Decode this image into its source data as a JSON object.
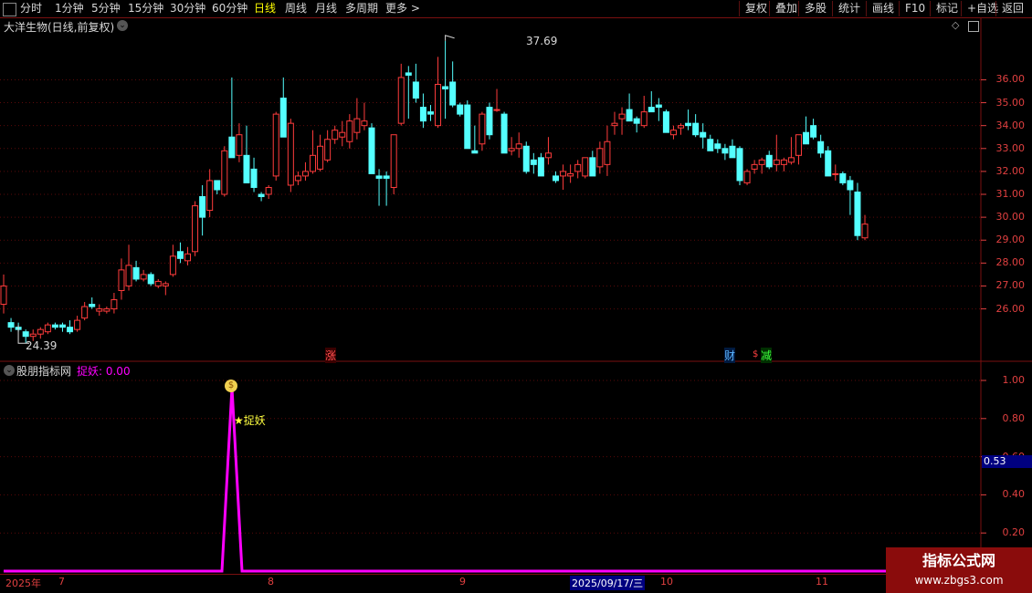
{
  "toolbar": {
    "left": [
      {
        "label": "分时"
      },
      {
        "label": "1分钟"
      },
      {
        "label": "5分钟"
      },
      {
        "label": "15分钟"
      },
      {
        "label": "30分钟"
      },
      {
        "label": "60分钟"
      },
      {
        "label": "日线",
        "active": true
      },
      {
        "label": "周线"
      },
      {
        "label": "月线"
      },
      {
        "label": "多周期"
      },
      {
        "label": "更多 >"
      }
    ],
    "right": [
      {
        "label": "复权"
      },
      {
        "label": "叠加"
      },
      {
        "label": "多股"
      },
      {
        "label": "统计"
      },
      {
        "label": "画线"
      },
      {
        "label": "F10"
      },
      {
        "label": "标记"
      },
      {
        "label": "+自选"
      },
      {
        "label": "返回"
      }
    ]
  },
  "stock_title": "大洋生物(日线,前复权)",
  "max_label": "37.69",
  "min_label": "24.39",
  "price_axis": [
    "36.00",
    "35.00",
    "34.00",
    "33.00",
    "32.00",
    "31.00",
    "30.00",
    "29.00",
    "28.00",
    "27.00",
    "26.00"
  ],
  "markers": {
    "zhang": "涨",
    "cai": "财",
    "jian": "减"
  },
  "indicator": {
    "source": "股朋指标网",
    "name_value": "捉妖: 0.00",
    "signal_label": "★捉妖",
    "axis": [
      "1.00",
      "0.80",
      "0.60",
      "0.40",
      "0.20"
    ],
    "current_value": "0.53"
  },
  "dates": {
    "year": "2025年",
    "m7": "7",
    "m8": "8",
    "m9": "9",
    "cursor": "2025/09/17/三",
    "m10": "10",
    "m11": "11"
  },
  "watermark": {
    "title": "指标公式网",
    "url": "www.zbgs3.com"
  },
  "colors": {
    "up": "#ff3c3c",
    "down": "#54ffff",
    "indicator": "#ff00ff",
    "axis": "#e04040",
    "grid": "#5a0a0a"
  },
  "chart_data": {
    "type": "candlestick",
    "ohlc": [
      [
        26.2,
        27.5,
        25.8,
        27.0
      ],
      [
        25.4,
        25.6,
        25.0,
        25.2
      ],
      [
        25.2,
        25.4,
        25.0,
        25.1
      ],
      [
        25.0,
        25.1,
        24.5,
        24.8
      ],
      [
        24.8,
        25.1,
        24.6,
        24.9
      ],
      [
        24.9,
        25.2,
        24.7,
        25.1
      ],
      [
        25.0,
        25.4,
        24.9,
        25.3
      ],
      [
        25.3,
        25.4,
        25.1,
        25.2
      ],
      [
        25.3,
        25.4,
        25.0,
        25.2
      ],
      [
        25.2,
        25.5,
        24.9,
        25.0
      ],
      [
        25.1,
        25.7,
        25.0,
        25.5
      ],
      [
        25.6,
        26.3,
        25.5,
        26.1
      ],
      [
        26.2,
        26.5,
        26.0,
        26.1
      ],
      [
        25.9,
        26.2,
        25.7,
        26.0
      ],
      [
        25.9,
        26.1,
        25.8,
        26.0
      ],
      [
        26.0,
        26.7,
        25.8,
        26.4
      ],
      [
        26.8,
        28.2,
        26.4,
        27.7
      ],
      [
        27.0,
        28.8,
        26.8,
        27.9
      ],
      [
        27.8,
        28.1,
        27.2,
        27.3
      ],
      [
        27.3,
        27.7,
        27.2,
        27.5
      ],
      [
        27.5,
        27.6,
        27.0,
        27.1
      ],
      [
        27.0,
        27.3,
        26.9,
        27.2
      ],
      [
        27.0,
        27.2,
        26.6,
        27.1
      ],
      [
        27.5,
        28.8,
        27.4,
        28.3
      ],
      [
        28.5,
        28.9,
        28.0,
        28.2
      ],
      [
        28.1,
        28.7,
        27.9,
        28.4
      ],
      [
        28.5,
        30.7,
        28.3,
        30.5
      ],
      [
        30.9,
        31.4,
        29.2,
        30.0
      ],
      [
        30.3,
        32.1,
        30.0,
        31.6
      ],
      [
        31.6,
        31.6,
        31.0,
        31.2
      ],
      [
        31.0,
        33.1,
        30.9,
        32.9
      ],
      [
        33.5,
        36.1,
        32.7,
        32.6
      ],
      [
        32.7,
        34.1,
        32.4,
        33.6
      ],
      [
        32.7,
        34.0,
        31.7,
        31.5
      ],
      [
        32.1,
        32.6,
        31.1,
        31.3
      ],
      [
        31.0,
        31.1,
        30.7,
        30.9
      ],
      [
        31.0,
        31.4,
        30.8,
        31.3
      ],
      [
        31.8,
        34.6,
        31.6,
        34.5
      ],
      [
        35.2,
        36.1,
        33.6,
        33.5
      ],
      [
        31.4,
        34.3,
        31.1,
        34.1
      ],
      [
        31.6,
        32.0,
        31.4,
        31.8
      ],
      [
        31.8,
        32.4,
        31.6,
        32.0
      ],
      [
        32.0,
        33.8,
        31.9,
        32.7
      ],
      [
        32.1,
        33.6,
        32.0,
        33.1
      ],
      [
        32.5,
        33.8,
        32.4,
        33.4
      ],
      [
        33.4,
        34.0,
        33.2,
        33.8
      ],
      [
        33.5,
        34.2,
        33.1,
        33.7
      ],
      [
        33.3,
        34.5,
        33.0,
        34.2
      ],
      [
        33.7,
        35.2,
        33.4,
        34.3
      ],
      [
        34.0,
        35.0,
        33.8,
        34.2
      ],
      [
        33.9,
        34.1,
        31.9,
        31.9
      ],
      [
        31.8,
        32.1,
        30.5,
        31.7
      ],
      [
        31.8,
        32.0,
        30.5,
        31.7
      ],
      [
        31.3,
        33.6,
        31.0,
        33.6
      ],
      [
        34.1,
        36.7,
        34.0,
        36.1
      ],
      [
        36.3,
        36.6,
        34.3,
        36.2
      ],
      [
        35.9,
        36.7,
        35.0,
        35.2
      ],
      [
        34.8,
        35.4,
        33.9,
        34.2
      ],
      [
        34.6,
        34.9,
        34.2,
        34.5
      ],
      [
        34.0,
        37.0,
        33.9,
        35.8
      ],
      [
        35.7,
        37.7,
        34.3,
        35.6
      ],
      [
        35.9,
        36.8,
        34.8,
        34.9
      ],
      [
        34.9,
        35.0,
        34.4,
        34.5
      ],
      [
        34.9,
        35.1,
        33.2,
        33.0
      ],
      [
        32.9,
        34.0,
        32.8,
        32.8
      ],
      [
        33.2,
        34.6,
        32.9,
        34.5
      ],
      [
        34.8,
        35.0,
        33.4,
        33.6
      ],
      [
        34.7,
        35.6,
        34.6,
        34.7
      ],
      [
        34.5,
        34.6,
        33.0,
        32.8
      ],
      [
        32.9,
        33.5,
        32.7,
        33.0
      ],
      [
        33.0,
        33.7,
        32.6,
        33.2
      ],
      [
        33.1,
        33.3,
        31.9,
        32.0
      ],
      [
        32.5,
        32.8,
        31.9,
        32.3
      ],
      [
        32.6,
        32.8,
        31.8,
        31.8
      ],
      [
        32.6,
        33.5,
        32.3,
        32.8
      ],
      [
        31.8,
        32.0,
        31.5,
        31.6
      ],
      [
        31.8,
        32.3,
        31.2,
        32.0
      ],
      [
        31.8,
        32.3,
        31.5,
        31.9
      ],
      [
        32.0,
        32.5,
        31.7,
        32.3
      ],
      [
        31.8,
        32.6,
        31.7,
        32.6
      ],
      [
        32.6,
        32.9,
        31.8,
        31.8
      ],
      [
        32.2,
        33.3,
        31.9,
        33.0
      ],
      [
        32.3,
        34.0,
        31.8,
        33.3
      ],
      [
        34.0,
        34.6,
        33.6,
        34.1
      ],
      [
        34.3,
        34.8,
        33.6,
        34.5
      ],
      [
        34.7,
        35.4,
        34.3,
        34.2
      ],
      [
        34.3,
        34.4,
        33.7,
        34.1
      ],
      [
        34.0,
        35.3,
        33.9,
        34.6
      ],
      [
        34.8,
        35.5,
        34.6,
        34.6
      ],
      [
        34.9,
        35.2,
        34.2,
        34.8
      ],
      [
        34.6,
        34.7,
        33.7,
        33.7
      ],
      [
        33.6,
        34.0,
        33.4,
        33.8
      ],
      [
        33.9,
        34.1,
        33.6,
        34.0
      ],
      [
        34.1,
        34.7,
        33.8,
        34.0
      ],
      [
        34.1,
        34.5,
        33.5,
        33.6
      ],
      [
        33.7,
        34.1,
        33.0,
        33.5
      ],
      [
        33.4,
        33.6,
        32.9,
        32.9
      ],
      [
        33.2,
        33.4,
        32.8,
        33.0
      ],
      [
        33.0,
        33.2,
        32.5,
        32.8
      ],
      [
        33.1,
        33.4,
        32.9,
        32.6
      ],
      [
        33.0,
        33.1,
        31.4,
        31.6
      ],
      [
        31.5,
        32.1,
        31.4,
        32.0
      ],
      [
        32.1,
        32.5,
        31.9,
        32.3
      ],
      [
        32.3,
        32.6,
        31.9,
        32.5
      ],
      [
        32.7,
        32.9,
        32.1,
        32.2
      ],
      [
        32.3,
        33.6,
        32.0,
        32.5
      ],
      [
        32.3,
        32.6,
        32.0,
        32.5
      ],
      [
        32.4,
        33.5,
        32.3,
        32.6
      ],
      [
        32.7,
        33.1,
        32.3,
        33.6
      ],
      [
        33.7,
        34.4,
        33.6,
        33.2
      ],
      [
        34.0,
        34.3,
        33.4,
        33.5
      ],
      [
        33.3,
        33.6,
        32.6,
        32.8
      ],
      [
        32.9,
        33.1,
        31.9,
        31.8
      ],
      [
        31.9,
        32.3,
        31.6,
        31.9
      ],
      [
        31.9,
        32.0,
        31.4,
        31.5
      ],
      [
        31.6,
        31.8,
        30.1,
        31.2
      ],
      [
        31.1,
        31.5,
        29.0,
        29.2
      ],
      [
        29.1,
        30.1,
        29.0,
        29.7
      ]
    ],
    "y_range": [
      24.39,
      37.69
    ],
    "indicator_series": {
      "name": "捉妖",
      "values": [
        0,
        0,
        0,
        0,
        0,
        0,
        0,
        0,
        0,
        0,
        0,
        0,
        0,
        0,
        0,
        0,
        0,
        0,
        0,
        0,
        0,
        0,
        0,
        0,
        1,
        0,
        0,
        0,
        0,
        0,
        0,
        0,
        0,
        0,
        0,
        0,
        0,
        0,
        0,
        0,
        0,
        0,
        0,
        0,
        0,
        0,
        0,
        0,
        0,
        0,
        0,
        0,
        0,
        0,
        0,
        0,
        0,
        0,
        0,
        0,
        0,
        0,
        0,
        0,
        0,
        0,
        0,
        0,
        0,
        0,
        0,
        0,
        0,
        0,
        0,
        0,
        0,
        0,
        0,
        0,
        0,
        0,
        0,
        0,
        0,
        0,
        0,
        0,
        0,
        0,
        0,
        0,
        0,
        0,
        0,
        0,
        0,
        0,
        0,
        0,
        0,
        0,
        0,
        0,
        0,
        0,
        0,
        0,
        0,
        0,
        0,
        0,
        0,
        0,
        0,
        0,
        0,
        0,
        0,
        0
      ],
      "ylim": [
        0,
        1.0
      ]
    }
  }
}
